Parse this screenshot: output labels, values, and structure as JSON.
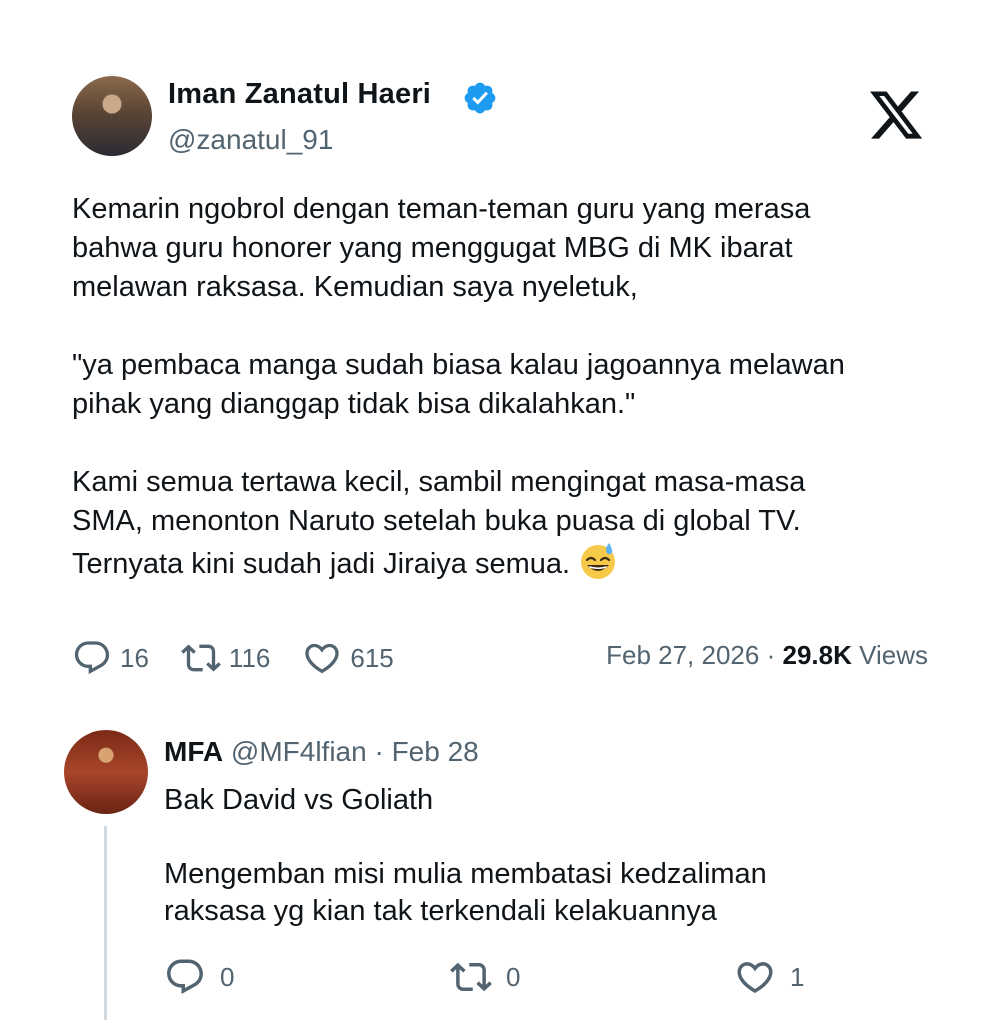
{
  "tweet": {
    "author_name": "Iman Zanatul Haeri",
    "handle": "@zanatul_91",
    "text": "Kemarin ngobrol dengan teman-teman guru yang merasa\nbahwa guru honorer yang menggugat MBG di MK ibarat\nmelawan raksasa. Kemudian saya nyeletuk,\n\n\"ya pembaca manga sudah biasa kalau jagoannya melawan\npihak yang dianggap tidak bisa dikalahkan.\"\n\nKami semua tertawa kecil, sambil mengingat masa-masa\nSMA, menonton Naruto setelah buka puasa di global TV.\nTernyata kini sudah jadi Jiraiya semua.",
    "emoji": "grinning-face-with-sweat",
    "replies": "16",
    "retweets": "116",
    "likes": "615",
    "date": "Feb 27, 2026",
    "separator": "·",
    "views_count": "29.8K",
    "views_label": "Views"
  },
  "reply": {
    "name": "MFA",
    "handle": "@MF4lfian",
    "separator": "·",
    "date": "Feb 28",
    "text": "Bak David vs Goliath\n\nMengemban misi mulia membatasi kedzaliman\nraksasa yg kian tak terkendali kelakuannya",
    "replies": "0",
    "retweets": "0",
    "likes": "1"
  },
  "colors": {
    "text": "#0f1419",
    "secondary": "#536471",
    "verified": "#1d9bf0",
    "thread_line": "#cfd9de"
  }
}
